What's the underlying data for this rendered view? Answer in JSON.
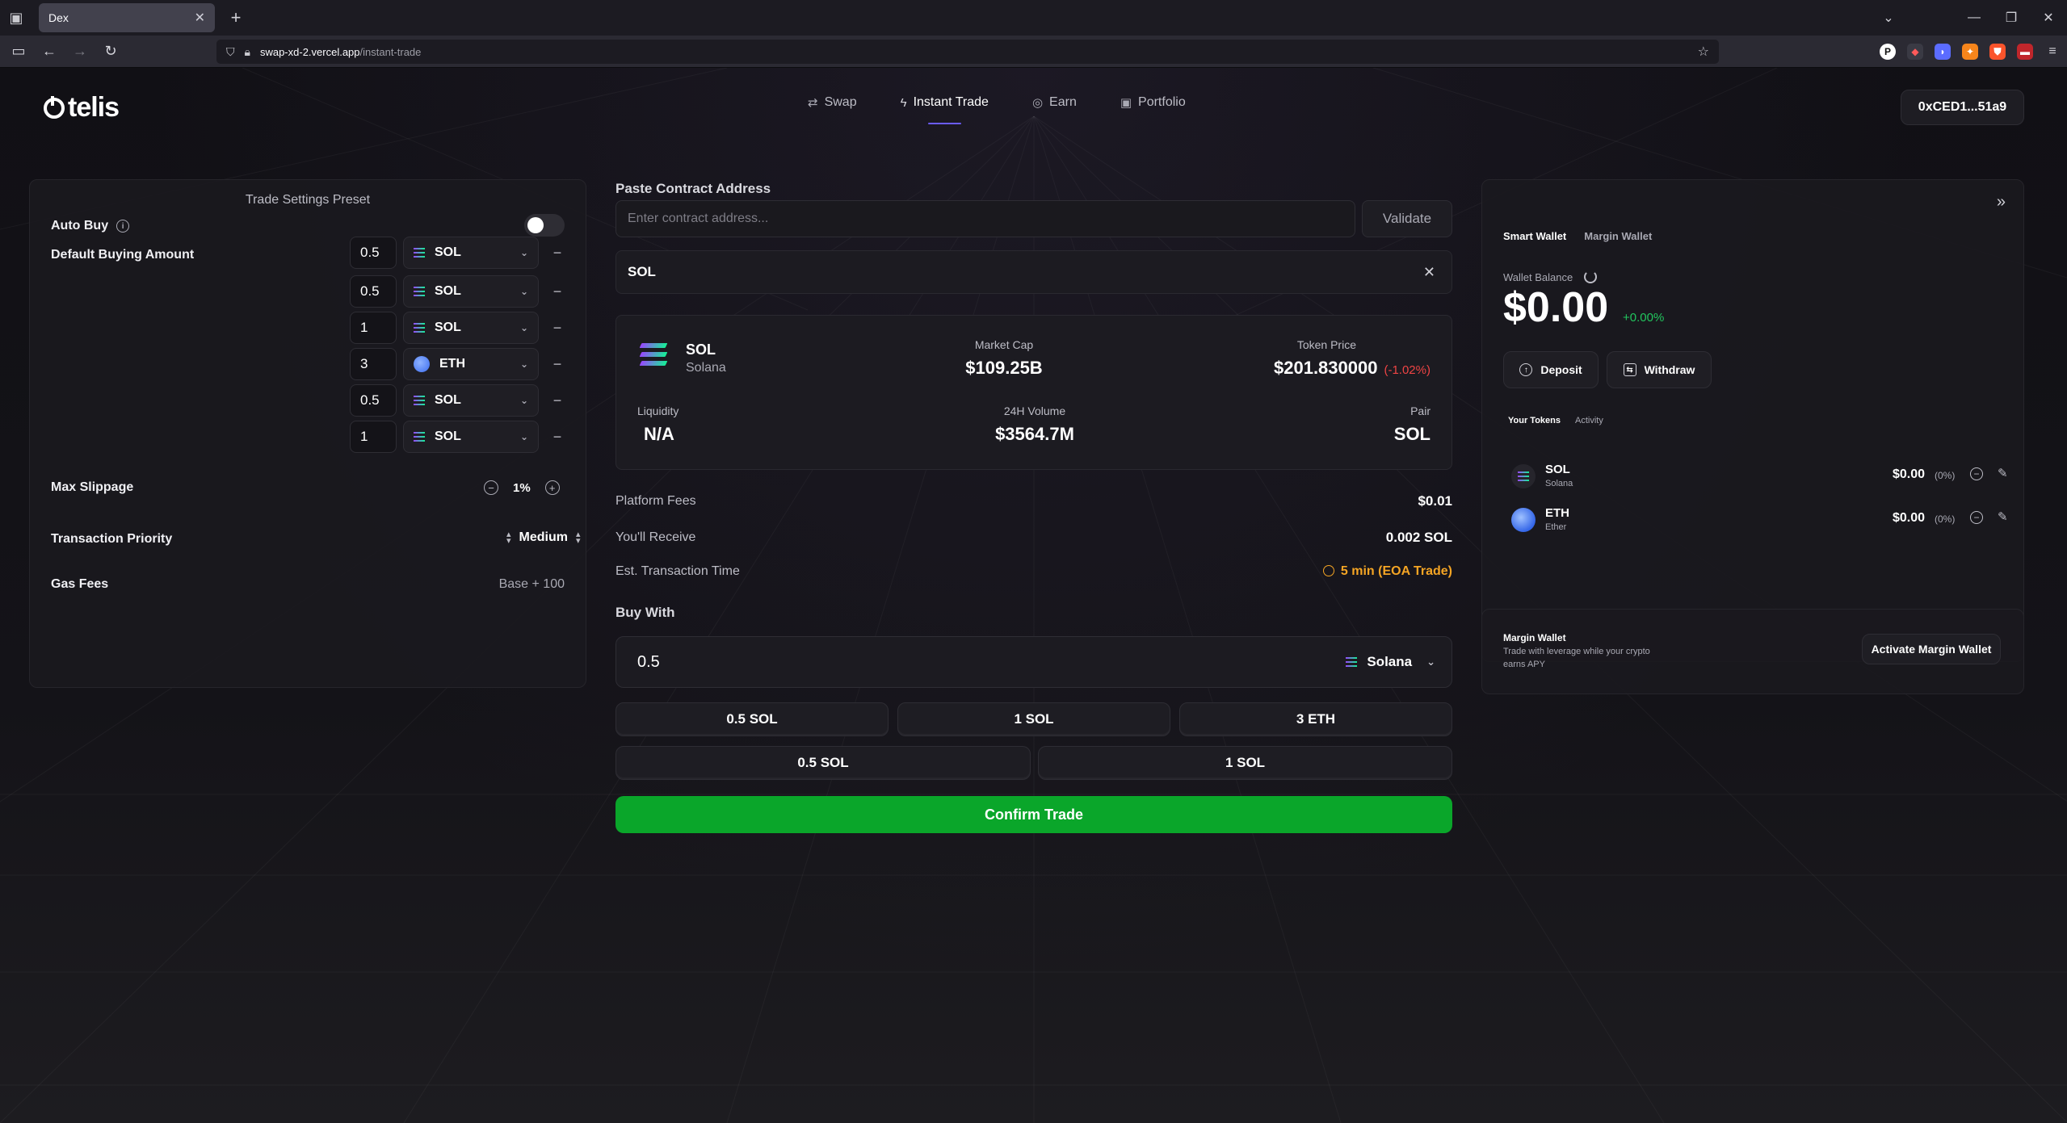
{
  "browser": {
    "tab_title": "Dex",
    "url_host": "swap-xd-2.vercel.app",
    "url_path": "/instant-trade"
  },
  "header": {
    "logo_text": "telis",
    "nav": [
      {
        "label": "Swap",
        "icon": "swap-icon"
      },
      {
        "label": "Instant Trade",
        "icon": "lightning-icon",
        "active": true
      },
      {
        "label": "Earn",
        "icon": "earn-icon"
      },
      {
        "label": "Portfolio",
        "icon": "portfolio-icon"
      }
    ],
    "wallet_address": "0xCED1...51a9"
  },
  "settings": {
    "title": "Trade Settings Preset",
    "auto_buy_label": "Auto Buy",
    "auto_buy_enabled": false,
    "default_buying_amount_label": "Default Buying Amount",
    "amounts": [
      {
        "value": "0.5",
        "token": "SOL"
      },
      {
        "value": "0.5",
        "token": "SOL"
      },
      {
        "value": "1",
        "token": "SOL"
      },
      {
        "value": "3",
        "token": "ETH"
      },
      {
        "value": "0.5",
        "token": "SOL"
      },
      {
        "value": "1",
        "token": "SOL"
      }
    ],
    "max_slippage_label": "Max Slippage",
    "max_slippage_value": "1%",
    "tx_priority_label": "Transaction Priority",
    "tx_priority_value": "Medium",
    "gas_fees_label": "Gas Fees",
    "gas_fees_value": "Base + 100"
  },
  "trade": {
    "contract_label": "Paste Contract Address",
    "contract_placeholder": "Enter contract address...",
    "validate_label": "Validate",
    "selected_token": "SOL",
    "token_card": {
      "symbol": "SOL",
      "name": "Solana",
      "market_cap_label": "Market Cap",
      "market_cap": "$109.25B",
      "token_price_label": "Token Price",
      "token_price": "$201.830000",
      "price_change": "(-1.02%)",
      "liquidity_label": "Liquidity",
      "liquidity": "N/A",
      "volume_label": "24H Volume",
      "volume": "$3564.7M",
      "pair_label": "Pair",
      "pair": "SOL"
    },
    "platform_fees_label": "Platform Fees",
    "platform_fees": "$0.01",
    "receive_label": "You'll Receive",
    "receive_value": "0.002 SOL",
    "est_time_label": "Est. Transaction Time",
    "est_time_value": "5 min (EOA Trade)",
    "buy_with_label": "Buy With",
    "buy_amount": "0.5",
    "buy_token": "Solana",
    "quick_row1": [
      "0.5 SOL",
      "1 SOL",
      "3 ETH"
    ],
    "quick_row2": [
      "0.5 SOL",
      "1 SOL"
    ],
    "confirm_label": "Confirm Trade"
  },
  "wallet": {
    "tabs": [
      "Smart Wallet",
      "Margin Wallet"
    ],
    "balance_label": "Wallet Balance",
    "balance": "$0.00",
    "balance_change": "+0.00%",
    "deposit_label": "Deposit",
    "withdraw_label": "Withdraw",
    "subtabs": [
      "Your Tokens",
      "Activity"
    ],
    "tokens": [
      {
        "symbol": "SOL",
        "name": "Solana",
        "value": "$0.00",
        "pct": "(0%)"
      },
      {
        "symbol": "ETH",
        "name": "Ether",
        "value": "$0.00",
        "pct": "(0%)"
      }
    ]
  },
  "margin": {
    "title": "Margin Wallet",
    "description": "Trade with leverage while your crypto earns APY",
    "button_label": "Activate Margin Wallet"
  },
  "colors": {
    "accent_green": "#0aa62a",
    "nav_underline": "#6b5cff",
    "negative": "#ef4444",
    "positive": "#22c55e",
    "warning": "#f5a524"
  }
}
